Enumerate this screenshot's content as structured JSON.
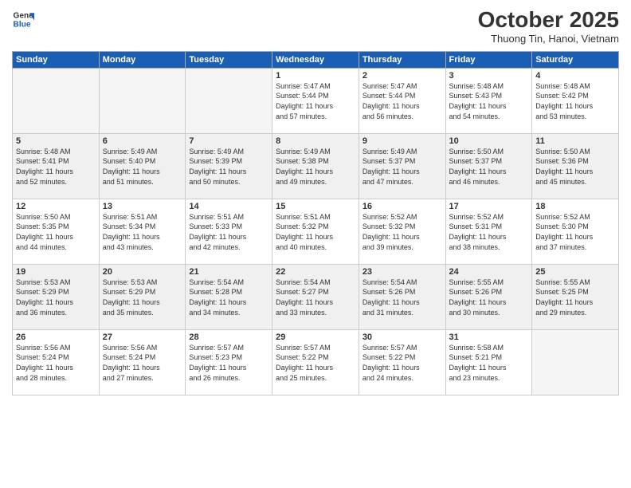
{
  "logo": {
    "line1": "General",
    "line2": "Blue"
  },
  "header": {
    "month": "October 2025",
    "location": "Thuong Tin, Hanoi, Vietnam"
  },
  "weekdays": [
    "Sunday",
    "Monday",
    "Tuesday",
    "Wednesday",
    "Thursday",
    "Friday",
    "Saturday"
  ],
  "weeks": [
    [
      {
        "day": "",
        "info": ""
      },
      {
        "day": "",
        "info": ""
      },
      {
        "day": "",
        "info": ""
      },
      {
        "day": "1",
        "info": "Sunrise: 5:47 AM\nSunset: 5:44 PM\nDaylight: 11 hours\nand 57 minutes."
      },
      {
        "day": "2",
        "info": "Sunrise: 5:47 AM\nSunset: 5:44 PM\nDaylight: 11 hours\nand 56 minutes."
      },
      {
        "day": "3",
        "info": "Sunrise: 5:48 AM\nSunset: 5:43 PM\nDaylight: 11 hours\nand 54 minutes."
      },
      {
        "day": "4",
        "info": "Sunrise: 5:48 AM\nSunset: 5:42 PM\nDaylight: 11 hours\nand 53 minutes."
      }
    ],
    [
      {
        "day": "5",
        "info": "Sunrise: 5:48 AM\nSunset: 5:41 PM\nDaylight: 11 hours\nand 52 minutes."
      },
      {
        "day": "6",
        "info": "Sunrise: 5:49 AM\nSunset: 5:40 PM\nDaylight: 11 hours\nand 51 minutes."
      },
      {
        "day": "7",
        "info": "Sunrise: 5:49 AM\nSunset: 5:39 PM\nDaylight: 11 hours\nand 50 minutes."
      },
      {
        "day": "8",
        "info": "Sunrise: 5:49 AM\nSunset: 5:38 PM\nDaylight: 11 hours\nand 49 minutes."
      },
      {
        "day": "9",
        "info": "Sunrise: 5:49 AM\nSunset: 5:37 PM\nDaylight: 11 hours\nand 47 minutes."
      },
      {
        "day": "10",
        "info": "Sunrise: 5:50 AM\nSunset: 5:37 PM\nDaylight: 11 hours\nand 46 minutes."
      },
      {
        "day": "11",
        "info": "Sunrise: 5:50 AM\nSunset: 5:36 PM\nDaylight: 11 hours\nand 45 minutes."
      }
    ],
    [
      {
        "day": "12",
        "info": "Sunrise: 5:50 AM\nSunset: 5:35 PM\nDaylight: 11 hours\nand 44 minutes."
      },
      {
        "day": "13",
        "info": "Sunrise: 5:51 AM\nSunset: 5:34 PM\nDaylight: 11 hours\nand 43 minutes."
      },
      {
        "day": "14",
        "info": "Sunrise: 5:51 AM\nSunset: 5:33 PM\nDaylight: 11 hours\nand 42 minutes."
      },
      {
        "day": "15",
        "info": "Sunrise: 5:51 AM\nSunset: 5:32 PM\nDaylight: 11 hours\nand 40 minutes."
      },
      {
        "day": "16",
        "info": "Sunrise: 5:52 AM\nSunset: 5:32 PM\nDaylight: 11 hours\nand 39 minutes."
      },
      {
        "day": "17",
        "info": "Sunrise: 5:52 AM\nSunset: 5:31 PM\nDaylight: 11 hours\nand 38 minutes."
      },
      {
        "day": "18",
        "info": "Sunrise: 5:52 AM\nSunset: 5:30 PM\nDaylight: 11 hours\nand 37 minutes."
      }
    ],
    [
      {
        "day": "19",
        "info": "Sunrise: 5:53 AM\nSunset: 5:29 PM\nDaylight: 11 hours\nand 36 minutes."
      },
      {
        "day": "20",
        "info": "Sunrise: 5:53 AM\nSunset: 5:29 PM\nDaylight: 11 hours\nand 35 minutes."
      },
      {
        "day": "21",
        "info": "Sunrise: 5:54 AM\nSunset: 5:28 PM\nDaylight: 11 hours\nand 34 minutes."
      },
      {
        "day": "22",
        "info": "Sunrise: 5:54 AM\nSunset: 5:27 PM\nDaylight: 11 hours\nand 33 minutes."
      },
      {
        "day": "23",
        "info": "Sunrise: 5:54 AM\nSunset: 5:26 PM\nDaylight: 11 hours\nand 31 minutes."
      },
      {
        "day": "24",
        "info": "Sunrise: 5:55 AM\nSunset: 5:26 PM\nDaylight: 11 hours\nand 30 minutes."
      },
      {
        "day": "25",
        "info": "Sunrise: 5:55 AM\nSunset: 5:25 PM\nDaylight: 11 hours\nand 29 minutes."
      }
    ],
    [
      {
        "day": "26",
        "info": "Sunrise: 5:56 AM\nSunset: 5:24 PM\nDaylight: 11 hours\nand 28 minutes."
      },
      {
        "day": "27",
        "info": "Sunrise: 5:56 AM\nSunset: 5:24 PM\nDaylight: 11 hours\nand 27 minutes."
      },
      {
        "day": "28",
        "info": "Sunrise: 5:57 AM\nSunset: 5:23 PM\nDaylight: 11 hours\nand 26 minutes."
      },
      {
        "day": "29",
        "info": "Sunrise: 5:57 AM\nSunset: 5:22 PM\nDaylight: 11 hours\nand 25 minutes."
      },
      {
        "day": "30",
        "info": "Sunrise: 5:57 AM\nSunset: 5:22 PM\nDaylight: 11 hours\nand 24 minutes."
      },
      {
        "day": "31",
        "info": "Sunrise: 5:58 AM\nSunset: 5:21 PM\nDaylight: 11 hours\nand 23 minutes."
      },
      {
        "day": "",
        "info": ""
      }
    ]
  ]
}
